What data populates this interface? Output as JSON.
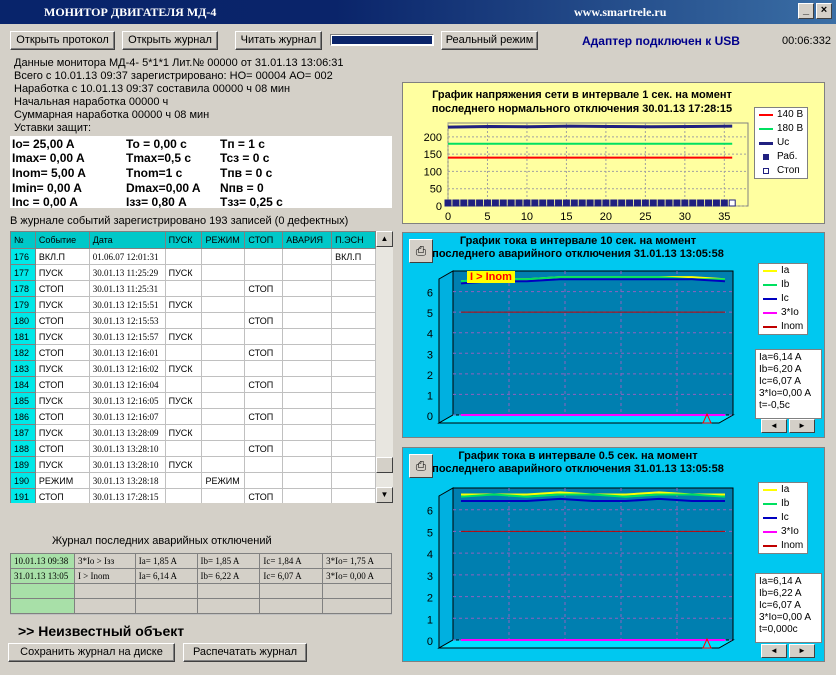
{
  "app": {
    "title": "МОНИТОР ДВИГАТЕЛЯ МД-4",
    "url": "www.smartrele.ru"
  },
  "toolbar": {
    "open_protocol": "Открыть протокол",
    "open_journal": "Открыть журнал",
    "read_journal": "Читать журнал",
    "real_mode": "Реальный режим",
    "adapter_status": "Адаптер подключен к USB",
    "clock": "00:06:332"
  },
  "monitor_info": [
    "Данные монитора  МД-4-   5*1*1   Лит.№ 00000  от 31.01.13  13:06:31",
    "Всего с        10.01.13  09:37  зарегистрировано:  НО=  00004  АО=  002",
    "Наработка с  10.01.13  09:37 составила  00000 ч  08  мин",
    "Начальная  наработка   00000 ч",
    "Суммарная  наработка   00000 ч  08  мин",
    "Уставки защит:"
  ],
  "protection": [
    {
      "c1": "Io=      25,00  A",
      "c2": "To  = 0,00 c",
      "c3": "Tп    =  1 c"
    },
    {
      "c1": "Imax=  0,00  A",
      "c2": "Tmax=0,5 c",
      "c3": "Tcз  =  0 c"
    },
    {
      "c1": "Inom= 5,00  A",
      "c2": "Tnom=1 c",
      "c3": "Tпв  =  0 c"
    },
    {
      "c1": "Imin=   0,00  A",
      "c2": "Dmax=0,00  A",
      "c3": "Nпв  =  0"
    },
    {
      "c1": "Inc  =  0,00  A",
      "c2": "Iзз=    0,80  A",
      "c3": "Tзз=    0,25 c"
    }
  ],
  "journal_summary": "В журнале событий зарегистрировано 193 записей (0 дефектных)",
  "events": {
    "headers": [
      "№",
      "Событие",
      "Дата",
      "ПУСК",
      "РЕЖИМ",
      "СТОП",
      "АВАРИЯ",
      "П.ЭСН"
    ],
    "rows": [
      [
        "176",
        "ВКЛ.П",
        "01.06.07  12:01:31",
        "",
        "",
        "",
        "",
        "ВКЛ.П"
      ],
      [
        "177",
        "ПУСК",
        "30.01.13  11:25:29",
        "ПУСК",
        "",
        "",
        "",
        ""
      ],
      [
        "178",
        "СТОП",
        "30.01.13  11:25:31",
        "",
        "",
        "СТОП",
        "",
        ""
      ],
      [
        "179",
        "ПУСК",
        "30.01.13  12:15:51",
        "ПУСК",
        "",
        "",
        "",
        ""
      ],
      [
        "180",
        "СТОП",
        "30.01.13  12:15:53",
        "",
        "",
        "СТОП",
        "",
        ""
      ],
      [
        "181",
        "ПУСК",
        "30.01.13  12:15:57",
        "ПУСК",
        "",
        "",
        "",
        ""
      ],
      [
        "182",
        "СТОП",
        "30.01.13  12:16:01",
        "",
        "",
        "СТОП",
        "",
        ""
      ],
      [
        "183",
        "ПУСК",
        "30.01.13  12:16:02",
        "ПУСК",
        "",
        "",
        "",
        ""
      ],
      [
        "184",
        "СТОП",
        "30.01.13  12:16:04",
        "",
        "",
        "СТОП",
        "",
        ""
      ],
      [
        "185",
        "ПУСК",
        "30.01.13  12:16:05",
        "ПУСК",
        "",
        "",
        "",
        ""
      ],
      [
        "186",
        "СТОП",
        "30.01.13  12:16:07",
        "",
        "",
        "СТОП",
        "",
        ""
      ],
      [
        "187",
        "ПУСК",
        "30.01.13  13:28:09",
        "ПУСК",
        "",
        "",
        "",
        ""
      ],
      [
        "188",
        "СТОП",
        "30.01.13  13:28:10",
        "",
        "",
        "СТОП",
        "",
        ""
      ],
      [
        "189",
        "ПУСК",
        "30.01.13  13:28:10",
        "ПУСК",
        "",
        "",
        "",
        ""
      ],
      [
        "190",
        "РЕЖИМ",
        "30.01.13  13:28:18",
        "",
        "РЕЖИМ",
        "",
        "",
        ""
      ],
      [
        "191",
        "СТОП",
        "30.01.13  17:28:15",
        "",
        "",
        "СТОП",
        "",
        ""
      ]
    ]
  },
  "crash_journal": {
    "title": "Журнал последних аварийных отключений",
    "rows": [
      [
        "10.01.13  09:38",
        "3*Io > Iзз",
        "Ia= 1,85  A",
        "Ib= 1,85  A",
        "Ic= 1,84  A",
        "3*Io= 1,75  A"
      ],
      [
        "31.01.13  13:05",
        "I > Inom",
        "Ia= 6,14  A",
        "Ib= 6,22  A",
        "Ic= 6,07  A",
        "3*Io= 0,00  A"
      ],
      [
        "",
        "",
        "",
        "",
        "",
        ""
      ],
      [
        "",
        "",
        "",
        "",
        "",
        ""
      ]
    ]
  },
  "object_label": ">> Неизвестный объект",
  "bottom": {
    "save": "Сохранить журнал на диске",
    "print": "Распечатать журнал"
  },
  "chart_voltage": {
    "title1": "График напряжения сети в интервале 1 сек. на момент",
    "title2": "последнего нормального отключения 30.01.13  17:28:15",
    "legend": [
      "140 В",
      "180 В",
      "Uc",
      "Раб.",
      "Стоп"
    ],
    "colors": {
      "bg": "#ffff90",
      "l140": "#ff0000",
      "l180": "#00e060",
      "uc": "#202080",
      "grid": "#808080"
    }
  },
  "chart_current10": {
    "title1": "График тока в интервале 10 сек. на момент",
    "title2": "последнего аварийного отключения 31.01.13  13:05:58",
    "legend": [
      "Ia",
      "Ib",
      "Ic",
      "3*Io",
      "Inom"
    ],
    "fault_label": "I > Inom",
    "readout": [
      "Ia=6,14  A",
      "Ib=6,20  A",
      "Ic=6,07  A",
      "3*Io=0,00  A",
      "t=-0,5c"
    ]
  },
  "chart_current05": {
    "title1": "График тока в интервале 0.5 сек. на момент",
    "title2": "последнего аварийного отключения 31.01.13  13:05:58",
    "legend": [
      "Ia",
      "Ib",
      "Ic",
      "3*Io",
      "Inom"
    ],
    "readout": [
      "Ia=6,14  A",
      "Ib=6,22  A",
      "Ic=6,07  A",
      "3*Io=0,00  A",
      "t=0,000c"
    ]
  },
  "chart_data": [
    {
      "type": "line",
      "title": "График напряжения сети в интервале 1 сек. на момент последнего нормального отключения 30.01.13  17:28:15",
      "x": [
        0,
        5,
        10,
        15,
        20,
        25,
        30,
        35
      ],
      "xlim": [
        0,
        38
      ],
      "ylim": [
        0,
        240
      ],
      "yticks": [
        0,
        50,
        100,
        150,
        200
      ],
      "series": [
        {
          "name": "140 В",
          "values": [
            140,
            140,
            140,
            140,
            140,
            140,
            140,
            140
          ]
        },
        {
          "name": "180 В",
          "values": [
            180,
            180,
            180,
            180,
            180,
            180,
            180,
            180
          ]
        },
        {
          "name": "Uc",
          "values": [
            228,
            230,
            229,
            231,
            230,
            229,
            230,
            231
          ]
        }
      ]
    },
    {
      "type": "line",
      "title": "График тока в интервале 10 сек. на момент последнего аварийного отключения 31.01.13  13:05:58",
      "ylim": [
        0,
        7
      ],
      "yticks": [
        0,
        1,
        2,
        3,
        4,
        5,
        6
      ],
      "series": [
        {
          "name": "Ia",
          "values": [
            6.5,
            6.6,
            6.6,
            6.7,
            6.7,
            6.7,
            6.7,
            6.7,
            6.6
          ]
        },
        {
          "name": "Ib",
          "values": [
            6.5,
            6.6,
            6.6,
            6.7,
            6.7,
            6.7,
            6.7,
            6.6,
            6.6
          ]
        },
        {
          "name": "Ic",
          "values": [
            6.4,
            6.5,
            6.5,
            6.6,
            6.6,
            6.6,
            6.6,
            6.6,
            6.5
          ]
        },
        {
          "name": "3*Io",
          "values": [
            0,
            0,
            0,
            0,
            0,
            0,
            0,
            0,
            0
          ]
        },
        {
          "name": "Inom",
          "values": [
            5,
            5,
            5,
            5,
            5,
            5,
            5,
            5,
            5
          ]
        }
      ]
    },
    {
      "type": "line",
      "title": "График тока в интервале 0.5 сек. на момент последнего аварийного отключения 31.01.13  13:05:58",
      "ylim": [
        0,
        7
      ],
      "yticks": [
        0,
        1,
        2,
        3,
        4,
        5,
        6
      ],
      "series": [
        {
          "name": "Ia",
          "values": [
            6.7,
            6.7,
            6.7,
            6.8,
            6.7,
            6.7,
            6.8,
            6.7,
            6.7
          ]
        },
        {
          "name": "Ib",
          "values": [
            6.6,
            6.7,
            6.6,
            6.7,
            6.7,
            6.6,
            6.7,
            6.7,
            6.6
          ]
        },
        {
          "name": "Ic",
          "values": [
            6.4,
            6.4,
            6.4,
            6.5,
            6.4,
            6.4,
            6.5,
            6.4,
            6.4
          ]
        },
        {
          "name": "3*Io",
          "values": [
            0,
            0,
            0,
            0,
            0,
            0,
            0,
            0,
            0
          ]
        },
        {
          "name": "Inom",
          "values": [
            5,
            5,
            5,
            5,
            5,
            5,
            5,
            5,
            5
          ]
        }
      ]
    }
  ]
}
